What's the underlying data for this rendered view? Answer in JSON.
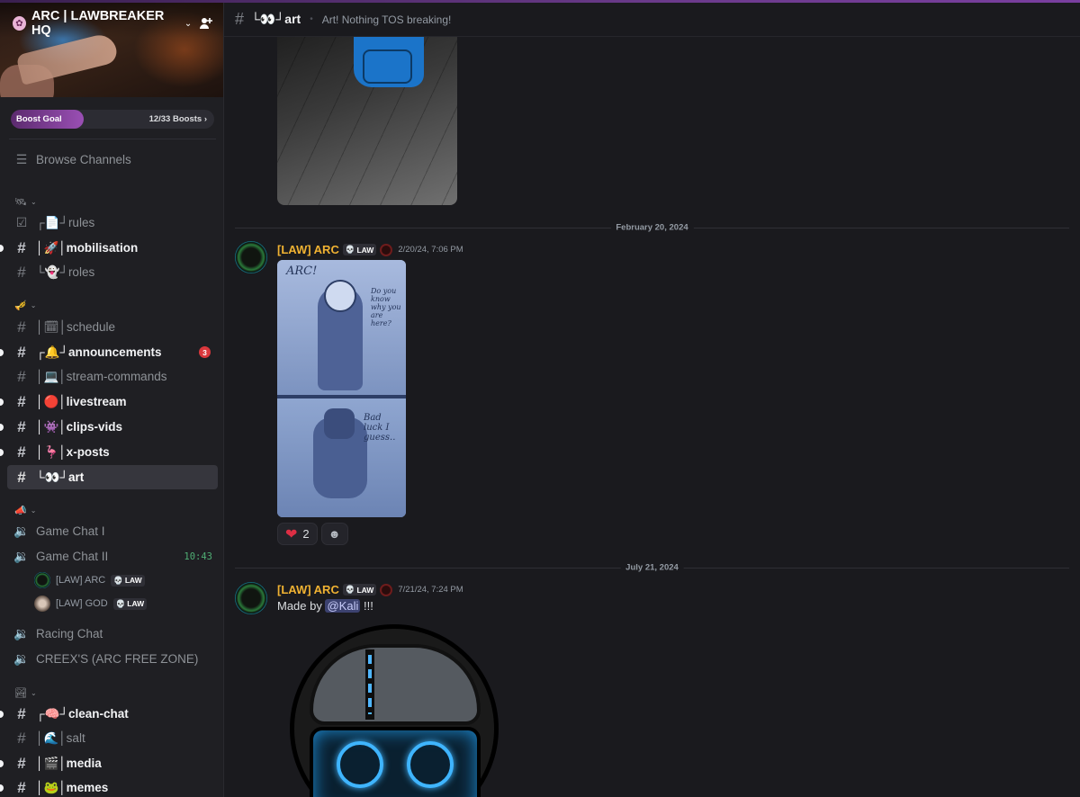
{
  "server": {
    "name": "ARC | LAWBREAKER HQ"
  },
  "boost": {
    "label": "Boost Goal",
    "count": "12/33 Boosts",
    "progress": 0.36
  },
  "sidebar": {
    "browse": "Browse Channels",
    "channels": [
      {
        "name": "┌📄┘rules"
      },
      {
        "name": "│🚀│mobilisation"
      },
      {
        "name": "└👻┘roles"
      },
      {
        "name": "│🗓│schedule"
      },
      {
        "name": "┌🔔┘announcements",
        "badge": "3"
      },
      {
        "name": "│💻│stream-commands"
      },
      {
        "name": "│🔴│livestream"
      },
      {
        "name": "│👾│clips-vids"
      },
      {
        "name": "│🦩│x-posts"
      },
      {
        "name": "└👀┘art"
      },
      {
        "name": "┌🧠┘clean-chat"
      },
      {
        "name": "│🌊│salt"
      },
      {
        "name": "│🎬│media"
      },
      {
        "name": "│🐸│memes"
      }
    ],
    "voice": [
      {
        "name": "Game Chat I"
      },
      {
        "name": "Game Chat II",
        "time": "10:43"
      },
      {
        "name": "Racing Chat"
      },
      {
        "name": "CREEX'S (ARC FREE ZONE)"
      }
    ],
    "voice_users": [
      {
        "name": "[LAW] ARC",
        "tag": "LAW"
      },
      {
        "name": "[LAW] GOD",
        "tag": "LAW"
      }
    ]
  },
  "header": {
    "channel": "└👀┘art",
    "topic": "Art! Nothing TOS breaking!"
  },
  "messages": [
    {
      "date": "February 20, 2024",
      "author": "[LAW] ARC",
      "tag": "LAW",
      "timestamp": "2/20/24, 7:06 PM",
      "comic_text_1": "ARC!",
      "comic_text_2": "Do you know why you are here?",
      "comic_text_3": "Bad luck I guess..",
      "reaction_count": "2"
    },
    {
      "date": "July 21, 2024",
      "author": "[LAW] ARC",
      "tag": "LAW",
      "timestamp": "7/21/24, 7:24 PM",
      "text_prefix": "Made by ",
      "mention": "@Kali",
      "text_suffix": " !!!"
    }
  ],
  "colors": {
    "username": "#f0b232",
    "unread_badge": "#da373c",
    "voice_time": "#4fae74"
  }
}
